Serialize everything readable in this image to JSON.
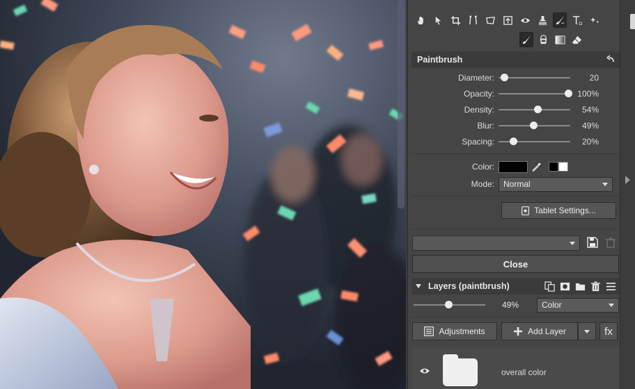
{
  "colors": {
    "panel_bg": "#454545",
    "section_bg": "#3b3b3b",
    "slider_thumb": "#ececec",
    "brush_color": "#000000",
    "layer_thumb": "#f0f0f0"
  },
  "toolbar": {
    "tools_row1": [
      "hand-icon",
      "pointer-icon",
      "crop-icon",
      "perspective-icon",
      "transform-icon",
      "upload-icon",
      "eye-icon",
      "stamp-icon",
      "brush-icon",
      "text-icon",
      "sparkle-icon"
    ],
    "tools_row2": [
      "paintbrush-icon",
      "bucket-icon",
      "gradient-icon",
      "eraser-icon"
    ]
  },
  "paintbrush": {
    "title": "Paintbrush",
    "sliders": [
      {
        "label": "Diameter:",
        "value": "20",
        "level": 0.08
      },
      {
        "label": "Opacity:",
        "value": "100%",
        "level": 0.97
      },
      {
        "label": "Density:",
        "value": "54%",
        "level": 0.54
      },
      {
        "label": "Blur:",
        "value": "49%",
        "level": 0.49
      },
      {
        "label": "Spacing:",
        "value": "20%",
        "level": 0.2
      }
    ],
    "color_label": "Color:",
    "mode_label": "Mode:",
    "mode_value": "Normal",
    "tablet_button": "Tablet Settings...",
    "close_button": "Close"
  },
  "layers": {
    "title": "Layers (paintbrush)",
    "opacity_value": "49%",
    "opacity_level": 0.49,
    "blend_mode": "Color",
    "adjustments_button": "Adjustments",
    "add_layer_button": "Add Layer",
    "fx_button": "fx",
    "items": [
      {
        "name": "overall color"
      }
    ]
  }
}
